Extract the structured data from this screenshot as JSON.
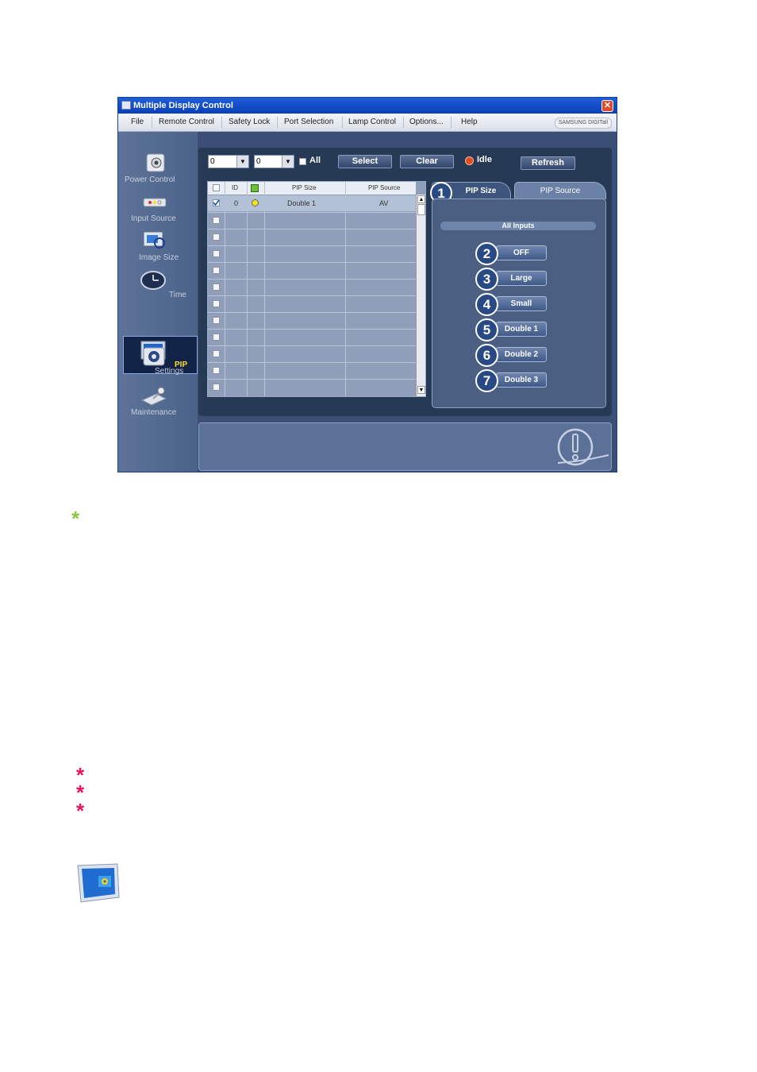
{
  "window": {
    "title": "Multiple Display Control",
    "close_glyph": "✕"
  },
  "menu": [
    "File",
    "Remote Control",
    "Safety Lock",
    "Port Selection",
    "Lamp Control",
    "Options...",
    "Help"
  ],
  "brand": "SAMSUNG DIGITall",
  "sidebar": {
    "items": [
      {
        "label": "Power Control",
        "icon": "power-control-icon"
      },
      {
        "label": "Input Source",
        "icon": "input-source-icon"
      },
      {
        "label": "Image Size",
        "icon": "image-size-icon"
      },
      {
        "label": "Time",
        "icon": "clock-icon"
      },
      {
        "label": "PIP",
        "icon": "pip-icon",
        "selected": true
      },
      {
        "label": "Settings",
        "icon": "settings-icon"
      },
      {
        "label": "Maintenance",
        "icon": "maintenance-icon"
      }
    ]
  },
  "toolbar": {
    "id_from": "0",
    "id_to": "0",
    "all_label": "All",
    "select_label": "Select",
    "clear_label": "Clear",
    "status": "Idle",
    "status_color": "#e14b22",
    "refresh_label": "Refresh"
  },
  "table": {
    "columns": [
      "ID",
      "PIP Size",
      "PIP Source"
    ],
    "rows": [
      {
        "checked": true,
        "id": "0",
        "status": "on",
        "pip_size": "Double 1",
        "pip_source": "AV"
      }
    ],
    "empty_rows": 11
  },
  "tabs": [
    {
      "label": "PIP Size",
      "active": true,
      "number": "1"
    },
    {
      "label": "PIP Source",
      "active": false
    }
  ],
  "panel": {
    "header": "All Inputs",
    "options": [
      {
        "number": "2",
        "label": "OFF"
      },
      {
        "number": "3",
        "label": "Large"
      },
      {
        "number": "4",
        "label": "Small"
      },
      {
        "number": "5",
        "label": "Double 1"
      },
      {
        "number": "6",
        "label": "Double 2"
      },
      {
        "number": "7",
        "label": "Double 3"
      }
    ]
  },
  "colors": {
    "note_star": "#8dc63f",
    "warn_star": "#e6145b",
    "accent_yellow": "#ffdc2e"
  },
  "page_stars": {
    "green": "*",
    "red": [
      "*",
      "*",
      "*"
    ]
  }
}
